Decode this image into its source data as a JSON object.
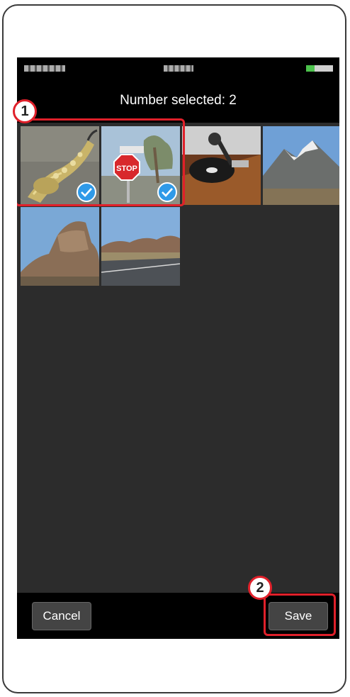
{
  "header": {
    "title": "Number selected: 2"
  },
  "photos": [
    {
      "subject": "saxophone",
      "selected": true
    },
    {
      "subject": "stop sign",
      "selected": true
    },
    {
      "subject": "record player",
      "selected": false
    },
    {
      "subject": "mountains",
      "selected": false
    },
    {
      "subject": "rock formation",
      "selected": false
    },
    {
      "subject": "desert road",
      "selected": false
    }
  ],
  "footer": {
    "cancel_label": "Cancel",
    "save_label": "Save"
  },
  "callouts": {
    "one": "1",
    "two": "2"
  },
  "colors": {
    "highlight": "#e0202a",
    "check": "#2f9ae8",
    "background": "#2c2c2c"
  }
}
